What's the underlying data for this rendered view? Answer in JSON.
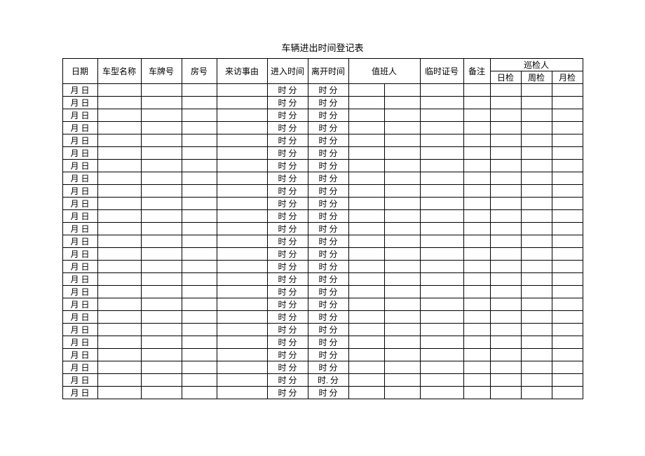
{
  "title": "车辆进出时间登记表",
  "headers": {
    "date": "日期",
    "model": "车型名称",
    "plate": "车牌号",
    "room": "房号",
    "reason": "来访事由",
    "enter": "进入时间",
    "leave": "离开时间",
    "duty": "值班人",
    "temp": "临时证号",
    "remark": "备注",
    "inspector": "巡检人",
    "daily": "日检",
    "weekly": "周检",
    "monthly": "月检"
  },
  "rows": [
    {
      "date": "月 日",
      "enter": "时 分",
      "leave": "时 分"
    },
    {
      "date": "月 日",
      "enter": "时 分",
      "leave": "时 分"
    },
    {
      "date": "月 日",
      "enter": "时 分",
      "leave": "时 分"
    },
    {
      "date": "月 日",
      "enter": "时 分",
      "leave": "时 分"
    },
    {
      "date": "月 日",
      "enter": "时 分",
      "leave": "时 分"
    },
    {
      "date": "月 日",
      "enter": "时 分",
      "leave": "时 分"
    },
    {
      "date": "月 日",
      "enter": "时 分",
      "leave": "时 分"
    },
    {
      "date": "月 日",
      "enter": "时 分",
      "leave": "时 分"
    },
    {
      "date": "月 日",
      "enter": "时 分",
      "leave": "时 分"
    },
    {
      "date": "月 日",
      "enter": "时 分",
      "leave": "时 分"
    },
    {
      "date": "月 日",
      "enter": "时 分",
      "leave": "时 分"
    },
    {
      "date": "月 日",
      "enter": "时 分",
      "leave": "时 分"
    },
    {
      "date": "月 日",
      "enter": "时 分",
      "leave": "时 分"
    },
    {
      "date": "月 日",
      "enter": "时 分",
      "leave": "时 分"
    },
    {
      "date": "月 日",
      "enter": "时 分",
      "leave": "时 分"
    },
    {
      "date": "月 日",
      "enter": "时 分",
      "leave": "时 分"
    },
    {
      "date": "月 日",
      "enter": "时 分",
      "leave": "时 分"
    },
    {
      "date": "月 日",
      "enter": "时 分",
      "leave": "时 分"
    },
    {
      "date": "月 日",
      "enter": "时 分",
      "leave": "时 分"
    },
    {
      "date": "月 日",
      "enter": "时 分",
      "leave": "时 分"
    },
    {
      "date": "月 日",
      "enter": "时 分",
      "leave": "时 分"
    },
    {
      "date": "月 日",
      "enter": "时 分",
      "leave": "时 分"
    },
    {
      "date": "月 日",
      "enter": "时 分",
      "leave": "时 分"
    },
    {
      "date": "月 日",
      "enter": "时 分",
      "leave": "时. 分"
    },
    {
      "date": "月 日",
      "enter": "时 分",
      "leave": "时 分"
    }
  ]
}
